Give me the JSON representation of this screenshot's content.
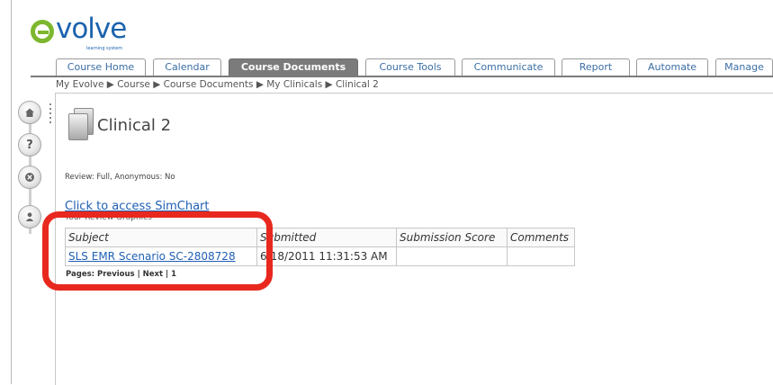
{
  "logo": {
    "text": "volve",
    "sub": "learning system"
  },
  "tabs": [
    {
      "label": "Course Home"
    },
    {
      "label": "Calendar"
    },
    {
      "label": "Course Documents",
      "active": true
    },
    {
      "label": "Course Tools"
    },
    {
      "label": "Communicate"
    },
    {
      "label": "Report"
    },
    {
      "label": "Automate"
    },
    {
      "label": "Manage"
    }
  ],
  "breadcrumb": "My Evolve ▶ Course ▶ Course Documents ▶ My Clinicals ▶ Clinical 2",
  "side_icons": [
    "home-icon",
    "help-icon",
    "close-icon",
    "user-icon"
  ],
  "side_glyphs": {
    "help": "?"
  },
  "page": {
    "title": "Clinical 2",
    "review": "Review: Full, Anonymous: No",
    "simchart_link": "Click to access SimChart",
    "partially_hidden": "Your Review Graphics"
  },
  "table": {
    "headers": [
      "Subject",
      "Submitted",
      "Submission Score",
      "Comments"
    ],
    "rows": [
      {
        "subject": "SLS EMR Scenario SC-2808728",
        "submitted": "6/18/2011 11:31:53 AM",
        "score": "",
        "comments": ""
      }
    ]
  },
  "pagination": {
    "prefix": "Pages:",
    "previous": "Previous",
    "sep1": " | ",
    "next": "Next",
    "sep2": " | ",
    "page": "1"
  },
  "colors": {
    "highlight": "#e8281e",
    "link": "#1f5fb4",
    "brand_green": "#7db72f",
    "brand_blue": "#1b62ae"
  }
}
